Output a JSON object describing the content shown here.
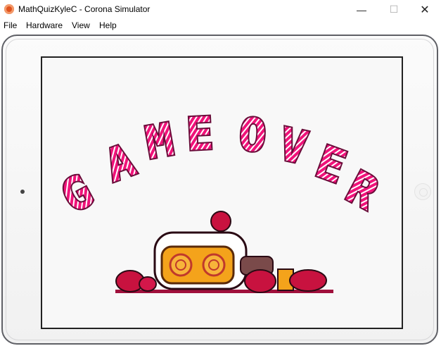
{
  "window": {
    "title": "MathQuizKyleC - Corona Simulator",
    "minimize_glyph": "—",
    "maximize_glyph": "☐",
    "close_glyph": "✕"
  },
  "menu": {
    "items": [
      "File",
      "Hardware",
      "View",
      "Help"
    ]
  },
  "game": {
    "banner_letters": [
      "G",
      "A",
      "M",
      "E",
      "O",
      "V",
      "E",
      "R"
    ]
  },
  "colors": {
    "accent": "#d81b60",
    "banner_fill": "#ff0066",
    "bomber_yellow": "#f4a31b"
  }
}
